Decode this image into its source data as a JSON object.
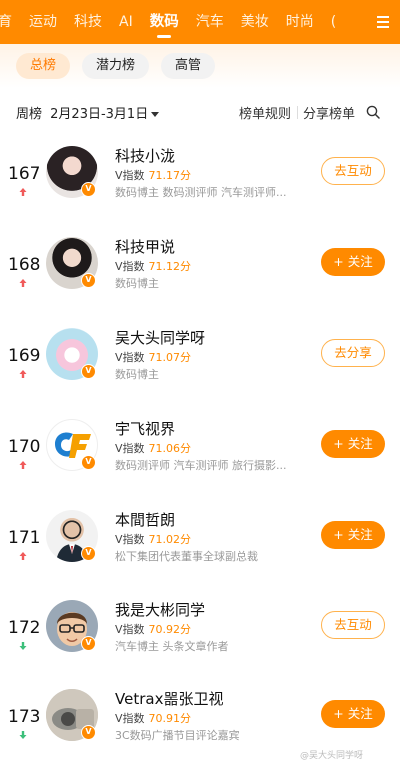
{
  "topnav": {
    "tabs": [
      "育",
      "运动",
      "科技",
      "AI",
      "数码",
      "汽车",
      "美妆",
      "时尚",
      "("
    ],
    "active_index": 4
  },
  "subtabs": [
    "总榜",
    "潜力榜",
    "高管"
  ],
  "filter": {
    "period_prefix": "周榜",
    "period": "2月23日-3月1日",
    "rules": "榜单规则",
    "share": "分享榜单"
  },
  "rows": [
    {
      "rank": "167",
      "trend": "up",
      "name": "科技小泷",
      "score_label": "V指数",
      "score": "71.17分",
      "tags": "数码博主 数码测评师 汽车测评师...",
      "action": "去互动",
      "action_style": "outline"
    },
    {
      "rank": "168",
      "trend": "up",
      "name": "科技甲说",
      "score_label": "V指数",
      "score": "71.12分",
      "tags": "数码博主",
      "action": "+ 关注",
      "action_style": "solid"
    },
    {
      "rank": "169",
      "trend": "up",
      "name": "吴大头同学呀",
      "score_label": "V指数",
      "score": "71.07分",
      "tags": "数码博主",
      "action": "去分享",
      "action_style": "outline"
    },
    {
      "rank": "170",
      "trend": "up",
      "name": "宇飞视界",
      "score_label": "V指数",
      "score": "71.06分",
      "tags": "数码测评师 汽车测评师 旅行摄影...",
      "action": "+ 关注",
      "action_style": "solid"
    },
    {
      "rank": "171",
      "trend": "up",
      "name": "本間哲朗",
      "score_label": "V指数",
      "score": "71.02分",
      "tags": "松下集团代表董事全球副总裁",
      "action": "+ 关注",
      "action_style": "solid"
    },
    {
      "rank": "172",
      "trend": "down",
      "name": "我是大彬同学",
      "score_label": "V指数",
      "score": "70.92分",
      "tags": "汽车博主 头条文章作者",
      "action": "去互动",
      "action_style": "outline"
    },
    {
      "rank": "173",
      "trend": "down",
      "name": "Vetrax噐张卫视",
      "score_label": "V指数",
      "score": "70.91分",
      "tags": "3C数码广播节目评论嘉宾",
      "action": "+ 关注",
      "action_style": "solid"
    }
  ],
  "watermark": "@吴大头同学呀",
  "colors": {
    "accent": "#ff8a00",
    "up": "#f05a5a",
    "down": "#3cbf7a"
  }
}
